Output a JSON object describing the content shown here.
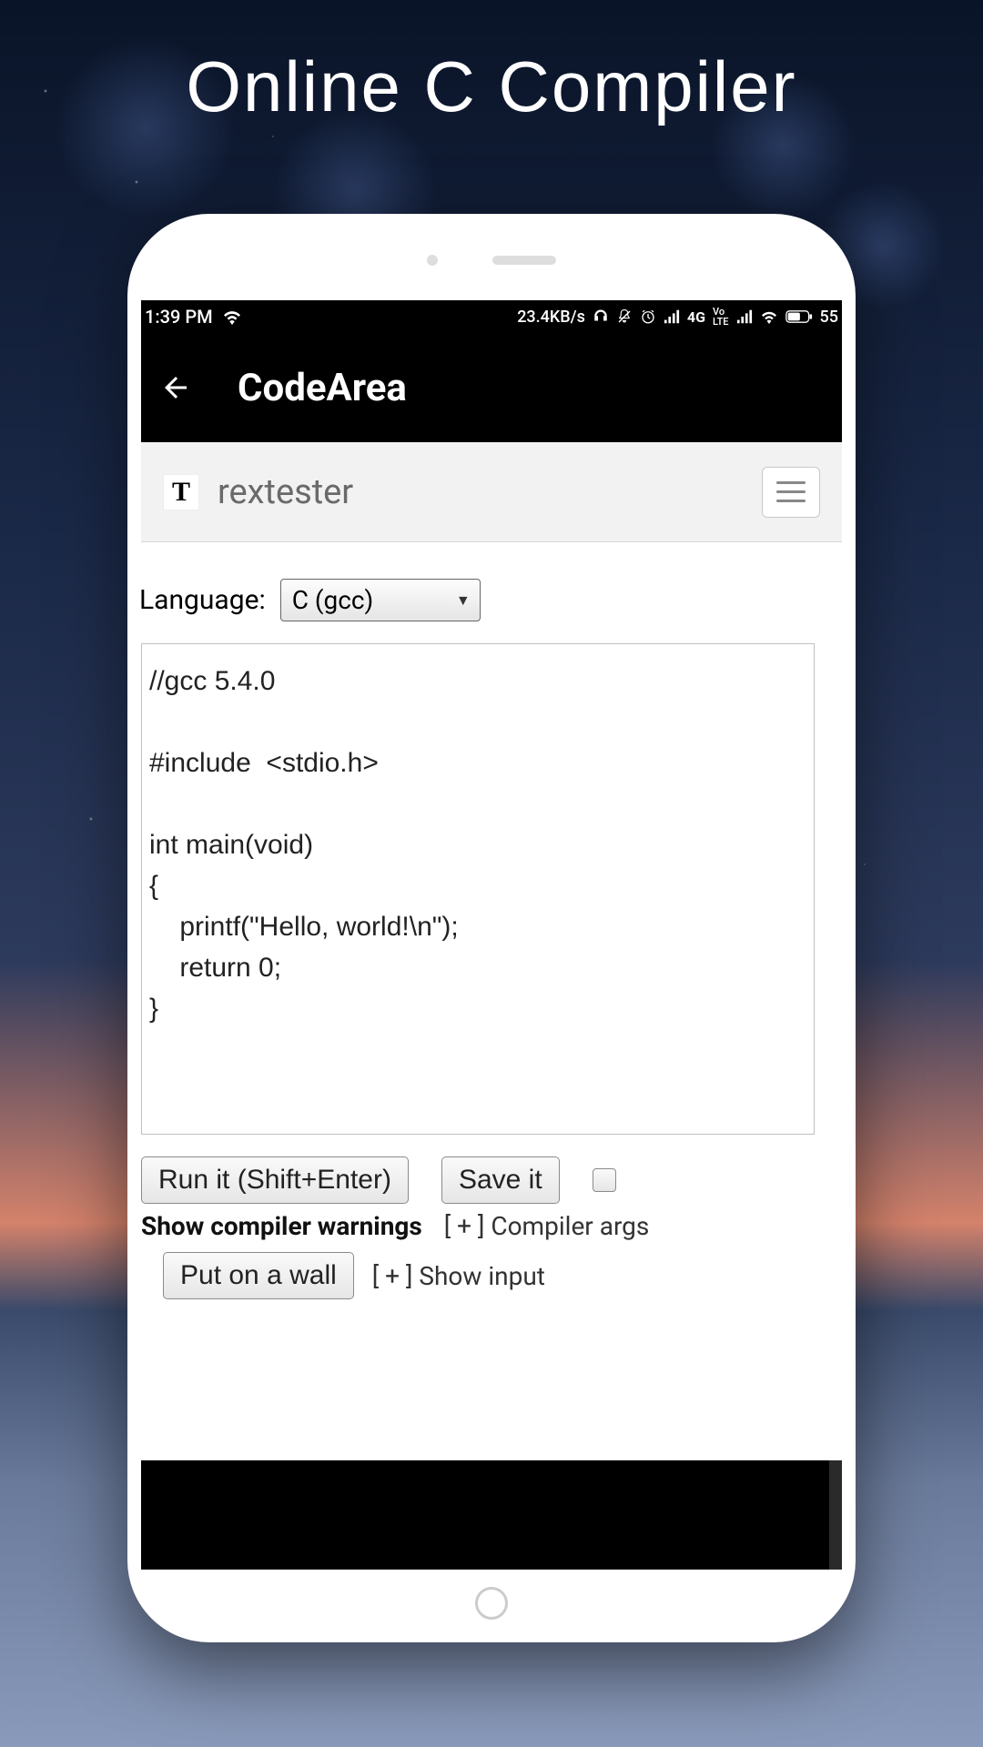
{
  "page": {
    "heading": "Online C Compiler"
  },
  "statusbar": {
    "time": "1:39 PM",
    "data_rate": "23.4KB/s",
    "network": "4G",
    "volte": "VoLTE",
    "battery_text": "55"
  },
  "appbar": {
    "title": "CodeArea"
  },
  "sitebar": {
    "logo_letter": "T",
    "name": "rextester"
  },
  "compiler": {
    "language_label": "Language:",
    "language_selected": "C (gcc)",
    "code": "//gcc 5.4.0\n\n#include  <stdio.h>\n\nint main(void)\n{\n    printf(\"Hello, world!\\n\");\n    return 0;\n}",
    "run_label": "Run it (Shift+Enter)",
    "save_label": "Save it",
    "show_warnings_label": "Show compiler warnings",
    "compiler_args_label": "[ + ] Compiler args",
    "put_on_wall_label": "Put on a wall",
    "show_input_label": "[ + ] Show input"
  }
}
